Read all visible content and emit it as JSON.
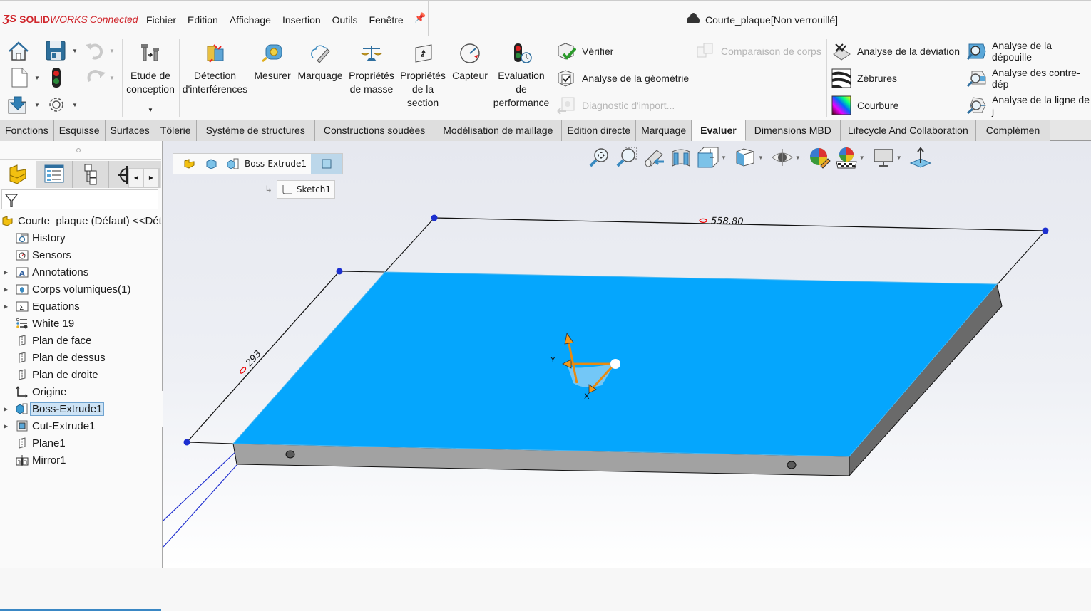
{
  "app": {
    "brand_prefix": "SOLID",
    "brand_suffix": "WORKS",
    "brand_edition": "Connected",
    "menu": [
      "Fichier",
      "Edition",
      "Affichage",
      "Insertion",
      "Outils",
      "Fenêtre"
    ],
    "document_title": "Courte_plaque[Non verrouillé]"
  },
  "ribbon": {
    "large_buttons": [
      {
        "id": "etude",
        "label": "Etude de\nconception",
        "icon": "design-study-icon"
      },
      {
        "id": "interference",
        "label": "Détection\nd'interférences",
        "icon": "interference-icon"
      },
      {
        "id": "measure",
        "label": "Mesurer",
        "icon": "measure-tape-icon"
      },
      {
        "id": "markup",
        "label": "Marquage",
        "icon": "markup-pen-icon"
      },
      {
        "id": "massprops",
        "label": "Propriétés\nde masse",
        "icon": "scale-icon"
      },
      {
        "id": "sectionprops",
        "label": "Propriétés\nde la\nsection",
        "icon": "section-props-icon"
      },
      {
        "id": "sensor",
        "label": "Capteur",
        "icon": "gauge-icon"
      },
      {
        "id": "perf",
        "label": "Evaluation\nde\nperformance",
        "icon": "performance-icon"
      }
    ],
    "small_buttons": [
      {
        "label": "Vérifier",
        "enabled": true,
        "icon": "check-cube-icon"
      },
      {
        "label": "Analyse de la géométrie",
        "enabled": true,
        "icon": "geometry-check-icon"
      },
      {
        "label": "Diagnostic d'import...",
        "enabled": false,
        "icon": "import-diagnostic-icon"
      },
      {
        "label": "Comparaison de corps",
        "enabled": false,
        "icon": "compare-bodies-icon"
      },
      {
        "label": "Analyse de la déviation",
        "enabled": true,
        "icon": "deviation-icon"
      },
      {
        "label": "Zébrures",
        "enabled": true,
        "icon": "zebra-icon"
      },
      {
        "label": "Courbure",
        "enabled": true,
        "icon": "curvature-icon"
      },
      {
        "label": "Analyse de la dépouille",
        "enabled": true,
        "icon": "draft-analysis-icon"
      },
      {
        "label": "Analyse des contre-dép",
        "enabled": true,
        "icon": "undercut-icon"
      },
      {
        "label": "Analyse de la ligne de j",
        "enabled": true,
        "icon": "parting-line-icon"
      }
    ]
  },
  "tabs": [
    {
      "label": "Fonctions",
      "active": false
    },
    {
      "label": "Esquisse",
      "active": false
    },
    {
      "label": "Surfaces",
      "active": false
    },
    {
      "label": "Tôlerie",
      "active": false
    },
    {
      "label": "Système de structures",
      "active": false
    },
    {
      "label": "Constructions soudées",
      "active": false
    },
    {
      "label": "Modélisation de maillage",
      "active": false
    },
    {
      "label": "Edition directe",
      "active": false
    },
    {
      "label": "Marquage",
      "active": false
    },
    {
      "label": "Evaluer",
      "active": true
    },
    {
      "label": "Dimensions MBD",
      "active": false
    },
    {
      "label": "Lifecycle And Collaboration",
      "active": false
    },
    {
      "label": "Complémen",
      "active": false
    }
  ],
  "feature_tree": {
    "root": "Courte_plaque (Défaut) <<Dét",
    "items": [
      {
        "label": "History",
        "expandable": false,
        "icon": "history-folder-icon"
      },
      {
        "label": "Sensors",
        "expandable": false,
        "icon": "sensors-folder-icon"
      },
      {
        "label": "Annotations",
        "expandable": true,
        "icon": "annotations-folder-icon"
      },
      {
        "label": "Corps volumiques(1)",
        "expandable": true,
        "icon": "solid-bodies-folder-icon"
      },
      {
        "label": "Equations",
        "expandable": true,
        "icon": "equations-folder-icon"
      },
      {
        "label": "White 19",
        "expandable": false,
        "icon": "material-icon"
      },
      {
        "label": "Plan de face",
        "expandable": false,
        "icon": "plane-icon"
      },
      {
        "label": "Plan de dessus",
        "expandable": false,
        "icon": "plane-icon"
      },
      {
        "label": "Plan de droite",
        "expandable": false,
        "icon": "plane-icon"
      },
      {
        "label": "Origine",
        "expandable": false,
        "icon": "origin-icon"
      },
      {
        "label": "Boss-Extrude1",
        "expandable": true,
        "icon": "boss-extrude-icon",
        "selected": true
      },
      {
        "label": "Cut-Extrude1",
        "expandable": true,
        "icon": "cut-extrude-icon"
      },
      {
        "label": "Plane1",
        "expandable": false,
        "icon": "plane-icon"
      },
      {
        "label": "Mirror1",
        "expandable": false,
        "icon": "mirror-icon"
      }
    ]
  },
  "breadcrumb": {
    "feature": "Boss-Extrude1",
    "sketch": "Sketch1"
  },
  "viewport": {
    "dimension_length": "558.80",
    "dimension_width": "293",
    "axis_x": "X",
    "axis_y": "Y",
    "face_color": "#05a6fd",
    "side_color": "#a2a2a2"
  }
}
